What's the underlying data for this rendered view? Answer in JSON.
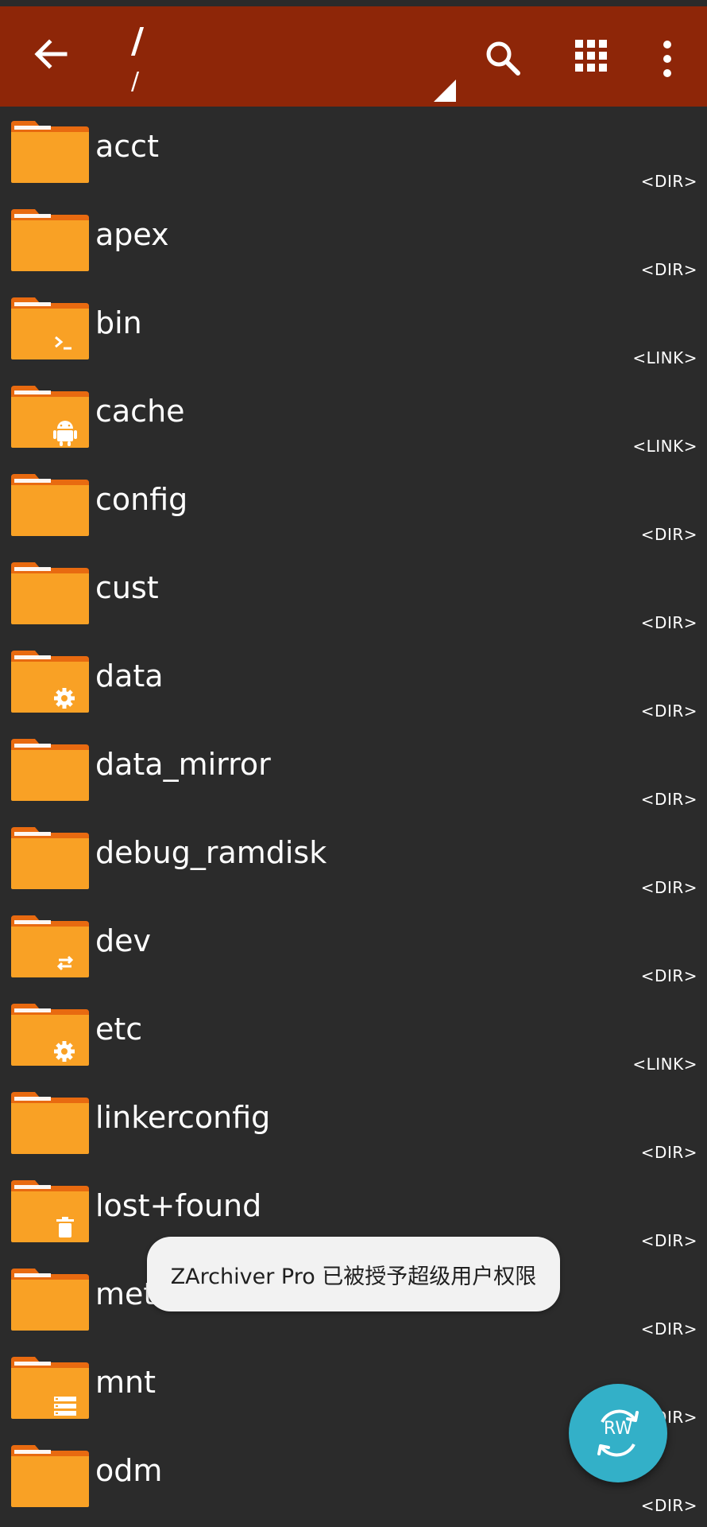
{
  "appbar": {
    "title": "/",
    "subtitle": "/",
    "back_icon": "arrow-back-icon",
    "search_icon": "search-icon",
    "view_icon": "grid-view-icon",
    "menu_icon": "more-vert-icon",
    "background_color": "#8e2608"
  },
  "files": [
    {
      "name": "acct",
      "type": "<DIR>",
      "badge": "none"
    },
    {
      "name": "apex",
      "type": "<DIR>",
      "badge": "none"
    },
    {
      "name": "bin",
      "type": "<LINK>",
      "badge": "terminal"
    },
    {
      "name": "cache",
      "type": "<LINK>",
      "badge": "android"
    },
    {
      "name": "config",
      "type": "<DIR>",
      "badge": "none"
    },
    {
      "name": "cust",
      "type": "<DIR>",
      "badge": "none"
    },
    {
      "name": "data",
      "type": "<DIR>",
      "badge": "gear"
    },
    {
      "name": "data_mirror",
      "type": "<DIR>",
      "badge": "none"
    },
    {
      "name": "debug_ramdisk",
      "type": "<DIR>",
      "badge": "none"
    },
    {
      "name": "dev",
      "type": "<DIR>",
      "badge": "swap"
    },
    {
      "name": "etc",
      "type": "<LINK>",
      "badge": "gear"
    },
    {
      "name": "linkerconfig",
      "type": "<DIR>",
      "badge": "none"
    },
    {
      "name": "lost+found",
      "type": "<DIR>",
      "badge": "trash"
    },
    {
      "name": "metadata",
      "type": "<DIR>",
      "badge": "none"
    },
    {
      "name": "mnt",
      "type": "<DIR>",
      "badge": "storage"
    },
    {
      "name": "odm",
      "type": "<DIR>",
      "badge": "none"
    }
  ],
  "toast": {
    "message": "ZArchiver Pro 已被授予超级用户权限"
  },
  "fab": {
    "label": "RW",
    "icon": "sync-icon",
    "color": "#33b0c8"
  },
  "colors": {
    "folder_front": "#f9a125",
    "folder_back": "#e86a10",
    "background": "#2b2b2b"
  }
}
